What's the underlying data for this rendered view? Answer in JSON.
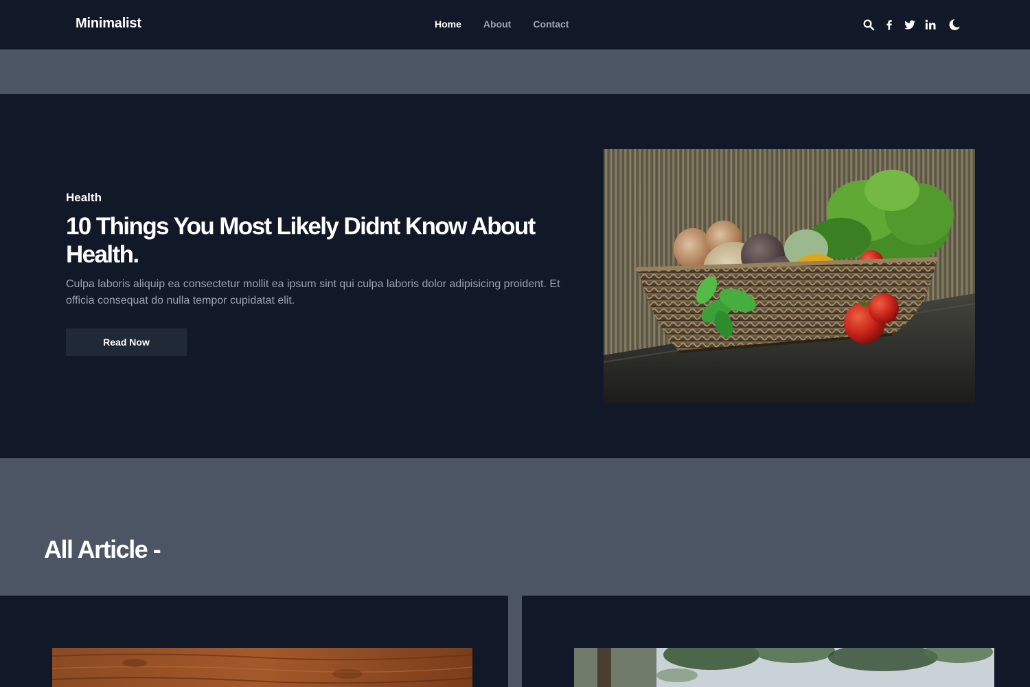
{
  "navbar": {
    "brand": "Minimalist",
    "links": [
      {
        "label": "Home",
        "active": true
      },
      {
        "label": "About",
        "active": false
      },
      {
        "label": "Contact",
        "active": false
      }
    ],
    "icons": [
      "search-icon",
      "facebook-icon",
      "twitter-icon",
      "linkedin-icon",
      "moon-icon"
    ]
  },
  "hero": {
    "category": "Health",
    "title": "10 Things You Most Likely Didnt Know About Health.",
    "description": "Culpa laboris aliquip ea consectetur mollit ea ipsum sint qui culpa laboris dolor adipisicing proident. Et officia consequat do nulla tempor cupidatat elit.",
    "button_label": "Read Now"
  },
  "articles": {
    "heading": "All Article -"
  },
  "colors": {
    "nav_bg": "#111827",
    "page_bg": "#4b5563",
    "button_bg": "#1f2937",
    "muted_text": "#9ca3af",
    "text": "#ffffff"
  }
}
